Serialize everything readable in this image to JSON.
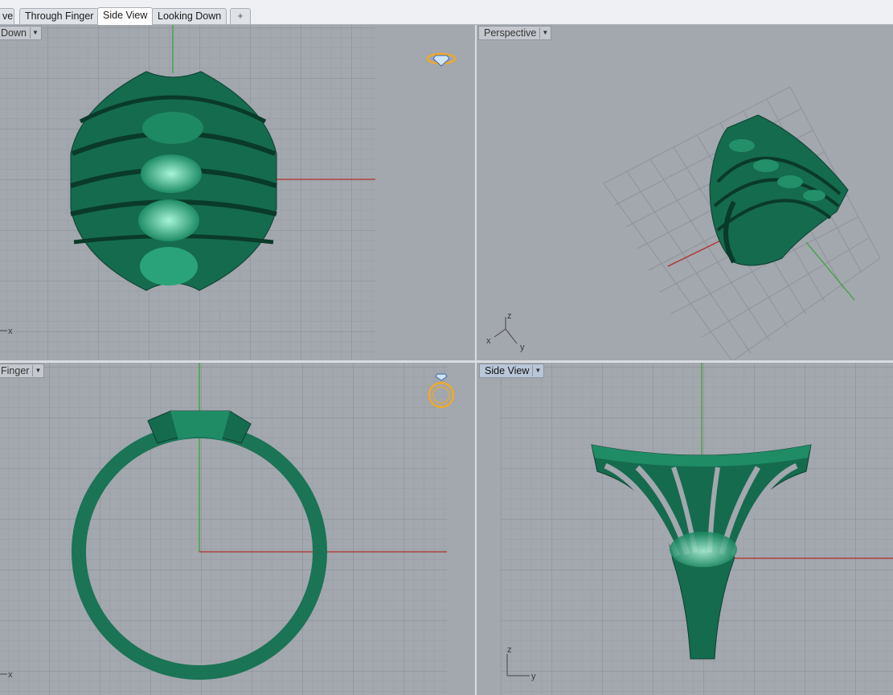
{
  "tabs": [
    {
      "label": "ve"
    },
    {
      "label": "Through Finger"
    },
    {
      "label": "Side View"
    },
    {
      "label": "Looking Down"
    },
    {
      "label": "+"
    }
  ],
  "active_tab": "Side View",
  "viewports": {
    "top_left": {
      "label": "Down",
      "axis_label_x": "x"
    },
    "top_right": {
      "label": "Perspective",
      "axis_z": "z",
      "axis_x": "x",
      "axis_y": "y"
    },
    "bottom_left": {
      "label": "Finger",
      "axis_label_x": "x"
    },
    "bottom_right": {
      "label": "Side View",
      "axis_z": "z",
      "axis_y": "y"
    }
  },
  "colors": {
    "viewport_bg": "#a3a7ae",
    "grid_minor": "#9a9ea5",
    "grid_major": "#8a8e95",
    "ring_green": "#1f7a5c",
    "ring_dark": "#0d4b37",
    "ring_highlight": "#7fe0c0",
    "axis_red": "#b1302a",
    "axis_green": "#3aa63a",
    "icon_orange": "#f0a92a"
  }
}
